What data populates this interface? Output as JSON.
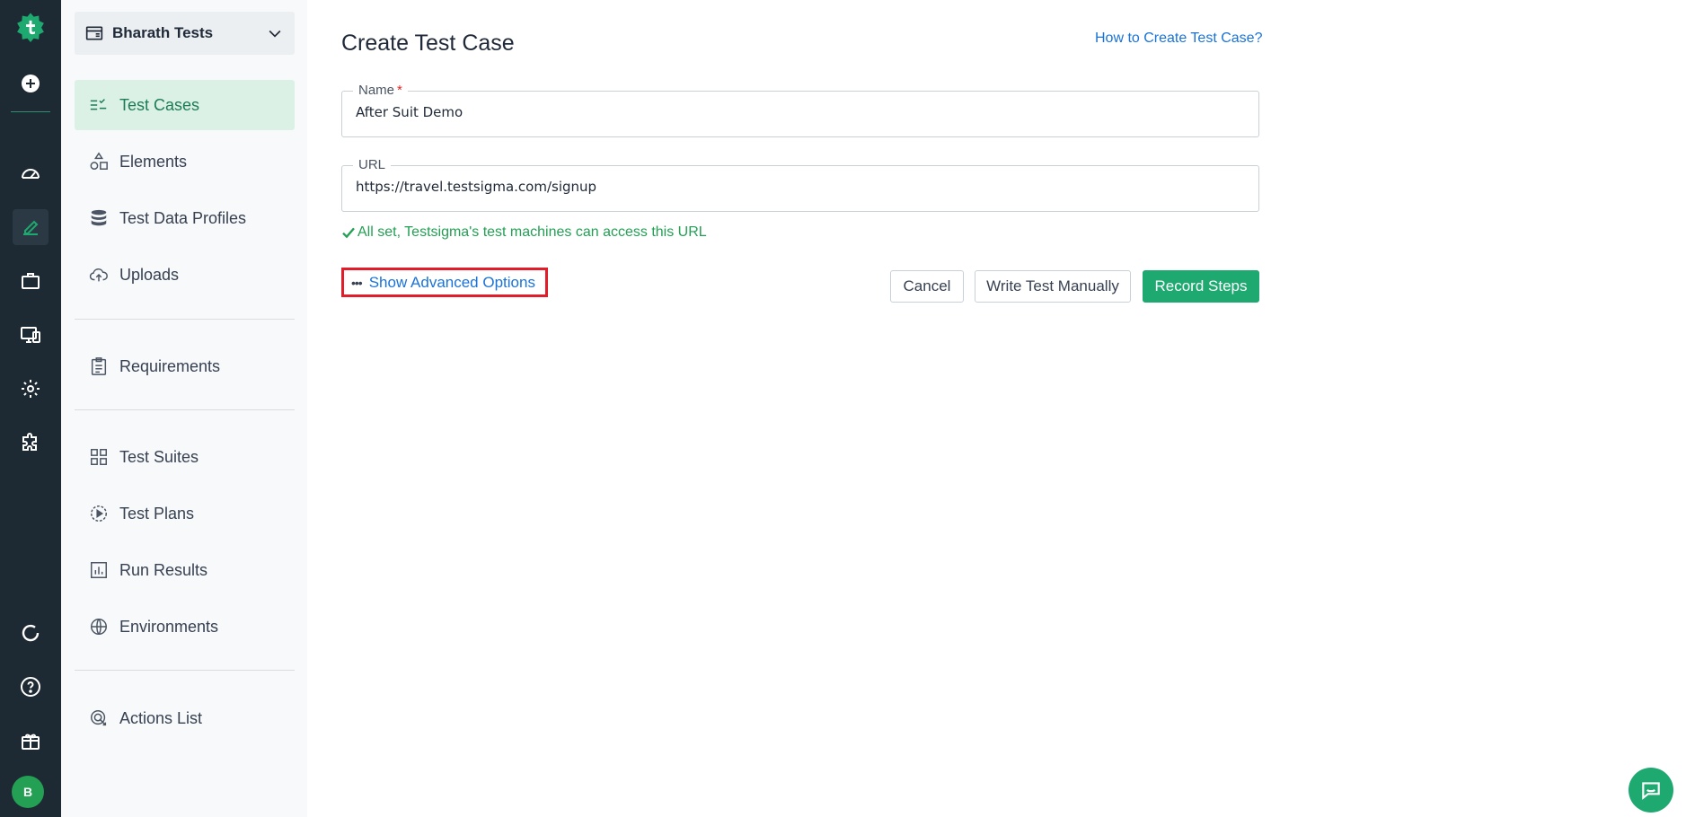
{
  "rail": {
    "logo_icon": "testsigma-logo-icon",
    "items": [
      "add-icon",
      "dashboard-icon",
      "edit-icon",
      "briefcase-icon",
      "devices-icon",
      "settings-icon",
      "addons-icon",
      "loading-icon",
      "help-icon",
      "gift-icon"
    ],
    "avatar_initial": "B"
  },
  "sidebar": {
    "project_name": "Bharath Tests",
    "items": [
      {
        "label": "Test Cases",
        "icon": "test-cases-icon"
      },
      {
        "label": "Elements",
        "icon": "elements-icon"
      },
      {
        "label": "Test Data Profiles",
        "icon": "database-icon"
      },
      {
        "label": "Uploads",
        "icon": "cloud-upload-icon"
      },
      {
        "label": "Requirements",
        "icon": "clipboard-icon"
      },
      {
        "label": "Test Suites",
        "icon": "grid-icon"
      },
      {
        "label": "Test Plans",
        "icon": "play-circle-icon"
      },
      {
        "label": "Run Results",
        "icon": "bar-chart-icon"
      },
      {
        "label": "Environments",
        "icon": "globe-icon"
      },
      {
        "label": "Actions List",
        "icon": "actions-icon"
      }
    ]
  },
  "main": {
    "title": "Create Test Case",
    "help_link": "How to Create Test Case?",
    "name_label": "Name",
    "name_required": "*",
    "name_value": "After Suit Demo",
    "url_label": "URL",
    "url_value": "https://travel.testsigma.com/signup",
    "url_status": "All set, Testsigma's test machines can access this URL",
    "advanced_dots": "•••",
    "advanced_label": "Show Advanced Options",
    "cancel_label": "Cancel",
    "manual_label": "Write Test Manually",
    "record_label": "Record Steps"
  },
  "colors": {
    "accent": "#1da96f",
    "rail_bg": "#1e2a33",
    "link": "#1a73d9",
    "highlight_box": "#e11d2a",
    "success": "#23a054"
  }
}
